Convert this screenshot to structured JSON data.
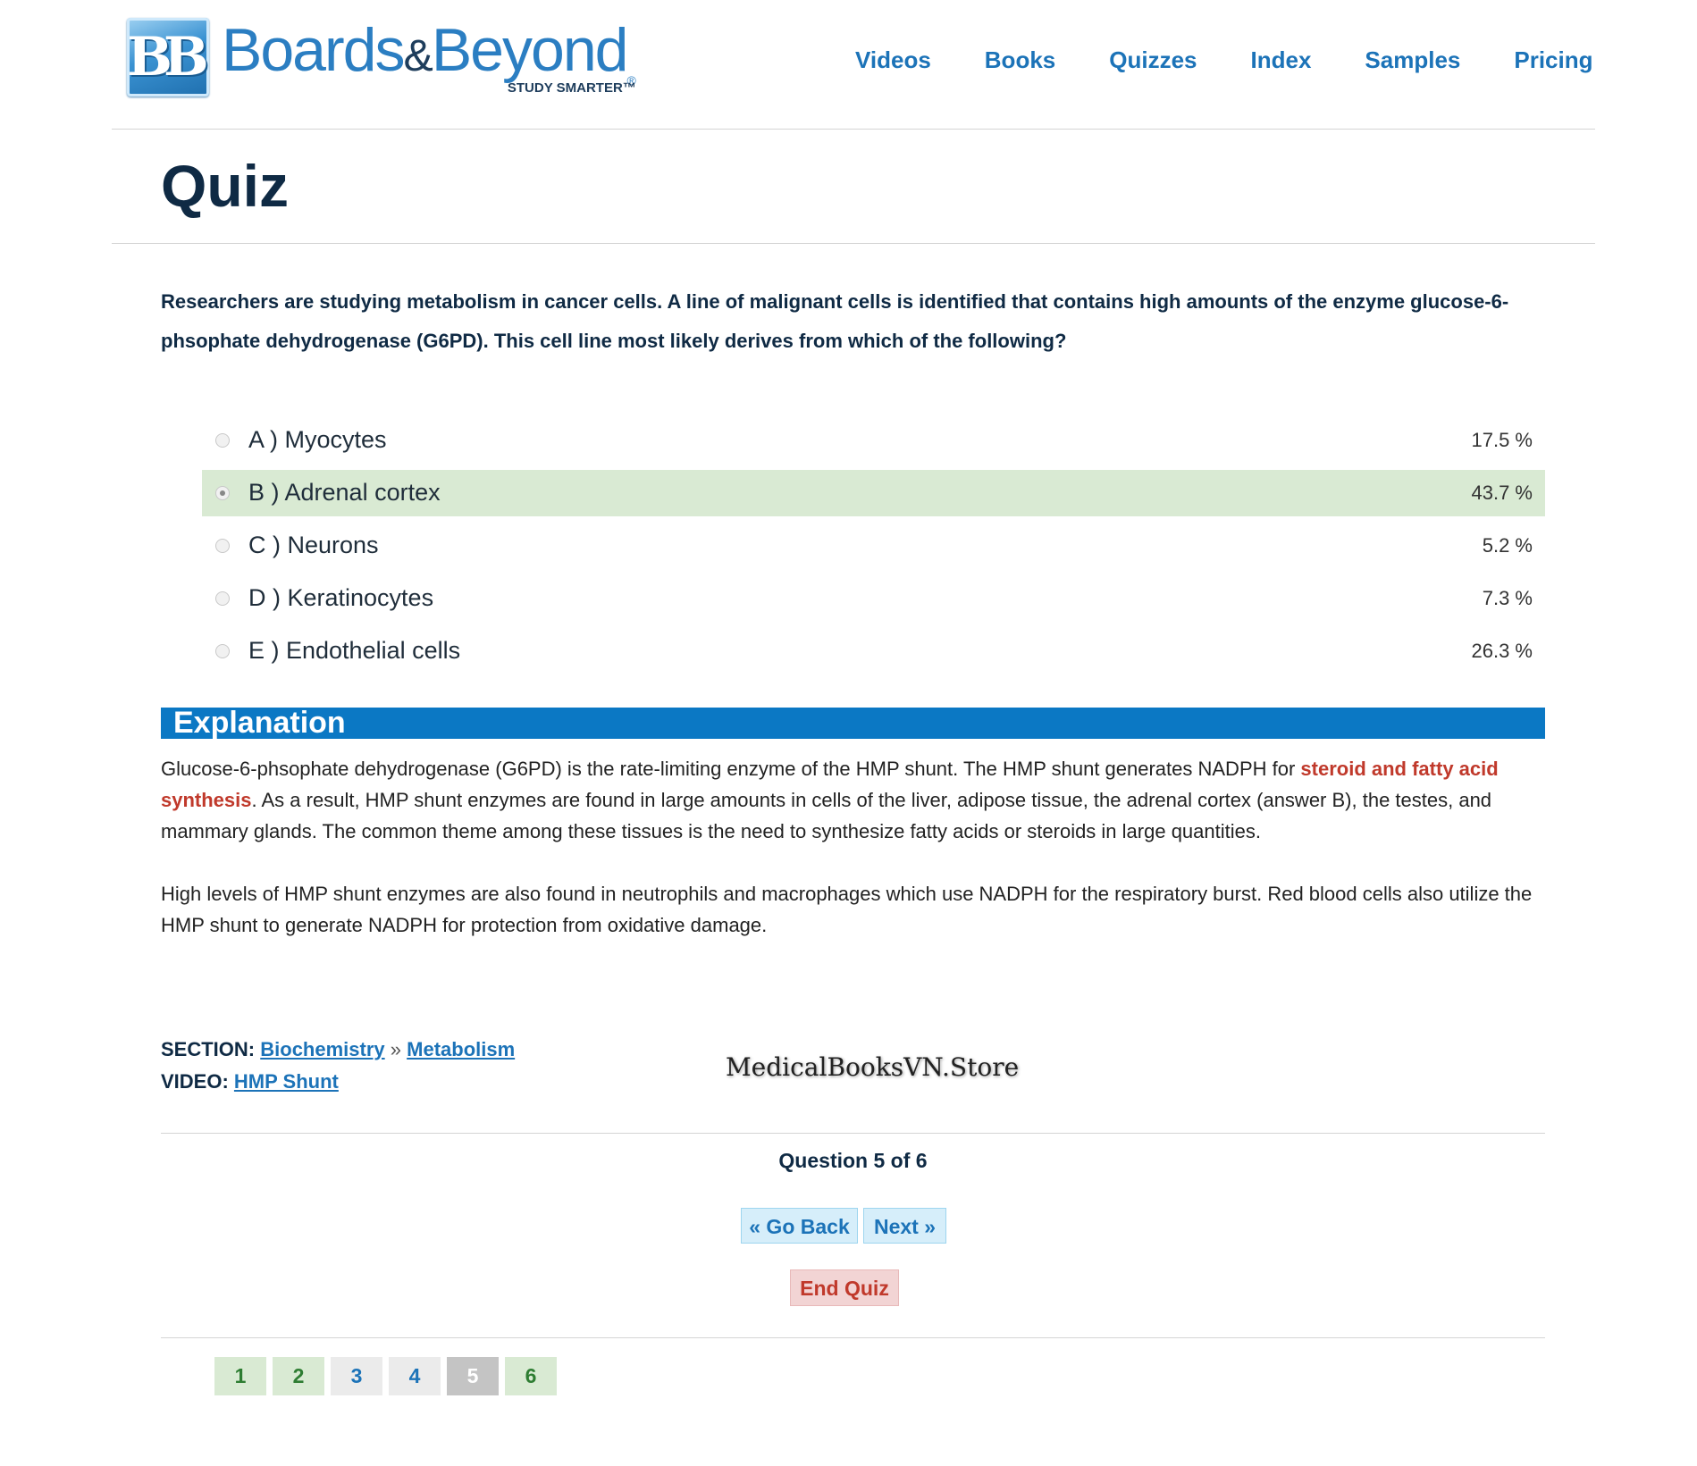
{
  "logo": {
    "badge": "BB",
    "name_1": "Boards",
    "amp": "&",
    "name_2": "Beyond",
    "reg": "®",
    "tagline": "STUDY SMARTER™"
  },
  "nav": [
    "Videos",
    "Books",
    "Quizzes",
    "Index",
    "Samples",
    "Pricing"
  ],
  "page_title": "Quiz",
  "question": "Researchers are studying metabolism in cancer cells. A line of malignant cells is identified that contains high amounts of the enzyme glucose-6-phsophate dehydrogenase (G6PD). This cell line most likely derives from which of the following?",
  "answers": [
    {
      "label": "A ) Myocytes",
      "percent": "17.5 %"
    },
    {
      "label": "B ) Adrenal cortex",
      "percent": "43.7 %"
    },
    {
      "label": "C ) Neurons",
      "percent": "5.2 %"
    },
    {
      "label": "D ) Keratinocytes",
      "percent": "7.3 %"
    },
    {
      "label": "E ) Endothelial cells",
      "percent": "26.3 %"
    }
  ],
  "selected_answer_index": 1,
  "explanation": {
    "title": "Explanation",
    "p1_before": "Glucose-6-phsophate dehydrogenase (G6PD) is the rate-limiting enzyme of the HMP shunt. The HMP shunt generates NADPH for ",
    "p1_highlight": "steroid and fatty acid synthesis",
    "p1_after": ". As a result, HMP shunt enzymes are found in large amounts in cells of the liver, adipose tissue, the adrenal cortex (answer B), the testes, and mammary glands. The common theme among these tissues is the need to synthesize fatty acids or steroids in large quantities.",
    "p2": "High levels of HMP shunt enzymes are also found in neutrophils and macrophages which use NADPH for the respiratory burst. Red blood cells also utilize the HMP shunt to generate NADPH for protection from oxidative damage."
  },
  "section": {
    "label": "SECTION:",
    "link1": "Biochemistry",
    "separator": "»",
    "link2": "Metabolism"
  },
  "video": {
    "label": "VIDEO:",
    "link": "HMP Shunt"
  },
  "watermark": "MedicalBooksVN.Store",
  "question_counter": "Question 5 of 6",
  "buttons": {
    "back": "« Go Back",
    "next": "Next »",
    "end": "End Quiz"
  },
  "pager": [
    {
      "label": "1",
      "state": "done"
    },
    {
      "label": "2",
      "state": "done"
    },
    {
      "label": "3",
      "state": "todo"
    },
    {
      "label": "4",
      "state": "todo"
    },
    {
      "label": "5",
      "state": "current"
    },
    {
      "label": "6",
      "state": "done"
    }
  ],
  "colors": {
    "brand_blue": "#1c73b8",
    "explanation_bar": "#0b78c4",
    "selected_row": "#d9ead3",
    "highlight_red": "#c0392b"
  }
}
